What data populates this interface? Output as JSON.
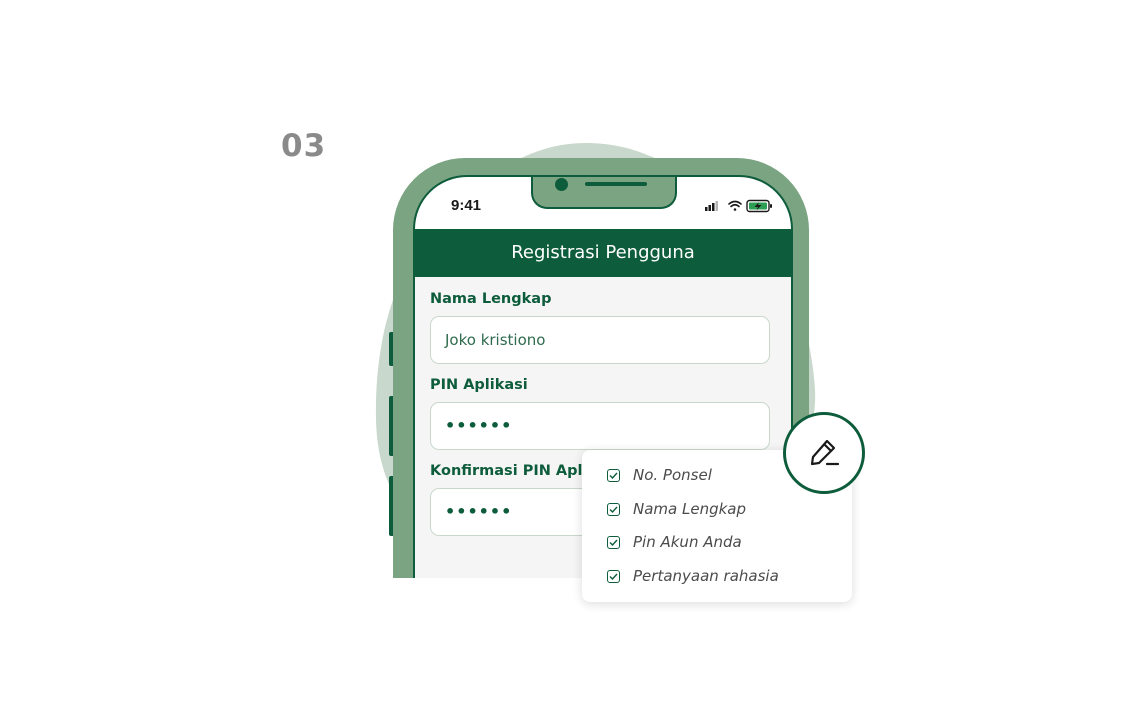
{
  "step": {
    "number": "03"
  },
  "colors": {
    "primary": "#0d5c3b",
    "phone_body": "#7aa482",
    "blob": "#c9d8cc",
    "muted": "#8a8a8a"
  },
  "status_bar": {
    "time": "9:41",
    "icons": [
      "signal-icon",
      "wifi-icon",
      "battery-charging-icon"
    ]
  },
  "app": {
    "title": "Registrasi Pengguna",
    "fields": [
      {
        "label": "Nama Lengkap",
        "value": "Joko kristiono"
      },
      {
        "label": "PIN Aplikasi",
        "value": "••••••"
      },
      {
        "label": "Konfirmasi PIN Aplikasi",
        "value": "••••••"
      }
    ]
  },
  "checklist": {
    "items": [
      {
        "label": "No. Ponsel",
        "checked": true
      },
      {
        "label": "Nama Lengkap",
        "checked": true
      },
      {
        "label": "Pin Akun Anda",
        "checked": true
      },
      {
        "label": "Pertanyaan rahasia",
        "checked": true
      }
    ]
  },
  "edit_button": {
    "icon": "pencil-edit-icon"
  }
}
